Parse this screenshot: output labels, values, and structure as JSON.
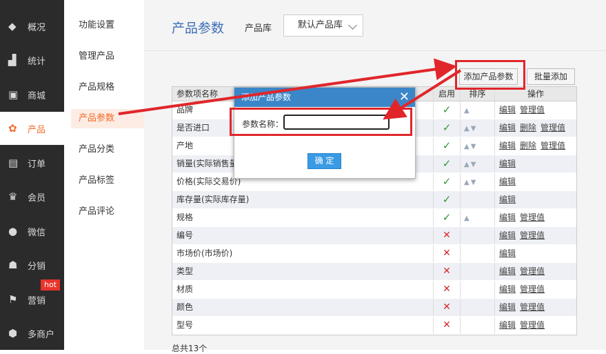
{
  "nav": [
    {
      "label": "概况",
      "icon": "layers-icon"
    },
    {
      "label": "统计",
      "icon": "chart-icon"
    },
    {
      "label": "商城",
      "icon": "store-icon"
    },
    {
      "label": "产品",
      "icon": "product-grid-icon",
      "active": true
    },
    {
      "label": "订单",
      "icon": "order-icon"
    },
    {
      "label": "会员",
      "icon": "crown-icon"
    },
    {
      "label": "微信",
      "icon": "wechat-icon"
    },
    {
      "label": "分销",
      "icon": "distribution-icon"
    },
    {
      "label": "营销",
      "icon": "flag-icon"
    },
    {
      "label": "多商户",
      "icon": "merchant-icon"
    }
  ],
  "hot_badge": "hot",
  "subnav": [
    {
      "label": "功能设置"
    },
    {
      "label": "管理产品"
    },
    {
      "label": "产品规格"
    },
    {
      "label": "产品参数",
      "active": true
    },
    {
      "label": "产品分类"
    },
    {
      "label": "产品标签"
    },
    {
      "label": "产品评论"
    }
  ],
  "header": {
    "title": "产品参数",
    "library_label": "产品库",
    "library_value": "默认产品库"
  },
  "toolbar": {
    "add_label": "添加产品参数",
    "batch_label": "批量添加"
  },
  "table": {
    "headers": [
      "参数项名称",
      "启用",
      "排序",
      "操作"
    ],
    "rows": [
      {
        "name": "品牌",
        "enabled": true,
        "sort": "up",
        "ops": [
          "编辑",
          "管理值"
        ]
      },
      {
        "name": "是否进口",
        "enabled": true,
        "sort": "updown",
        "ops": [
          "编辑",
          "删除",
          "管理值"
        ]
      },
      {
        "name": "产地",
        "enabled": true,
        "sort": "updown",
        "ops": [
          "编辑",
          "删除",
          "管理值"
        ]
      },
      {
        "name": "销量(实际销售量)",
        "enabled": true,
        "sort": "updown",
        "ops": [
          "编辑"
        ]
      },
      {
        "name": "价格(实际交易价)",
        "enabled": true,
        "sort": "updown",
        "ops": [
          "编辑"
        ]
      },
      {
        "name": "库存量(实际库存量)",
        "enabled": true,
        "sort": "",
        "ops": [
          "编辑"
        ]
      },
      {
        "name": "规格",
        "enabled": true,
        "sort": "up",
        "ops": [
          "编辑",
          "管理值"
        ]
      },
      {
        "name": "编号",
        "enabled": false,
        "sort": "",
        "ops": [
          "编辑",
          "管理值"
        ]
      },
      {
        "name": "市场价(市场价)",
        "enabled": false,
        "sort": "",
        "ops": [
          "编辑"
        ]
      },
      {
        "name": "类型",
        "enabled": false,
        "sort": "",
        "ops": [
          "编辑",
          "管理值"
        ]
      },
      {
        "name": "材质",
        "enabled": false,
        "sort": "",
        "ops": [
          "编辑",
          "管理值"
        ]
      },
      {
        "name": "颜色",
        "enabled": false,
        "sort": "",
        "ops": [
          "编辑",
          "管理值"
        ]
      },
      {
        "name": "型号",
        "enabled": false,
        "sort": "",
        "ops": [
          "编辑",
          "管理值"
        ]
      }
    ],
    "footer": "总共13个"
  },
  "dialog": {
    "title": "添加产品参数",
    "close": "✕",
    "field_label": "参数名称：",
    "field_value": "",
    "ok_label": "确 定"
  },
  "colors": {
    "accent": "#f26b2b",
    "dialog_header": "#3b86c8",
    "annotation": "#e0262b"
  }
}
